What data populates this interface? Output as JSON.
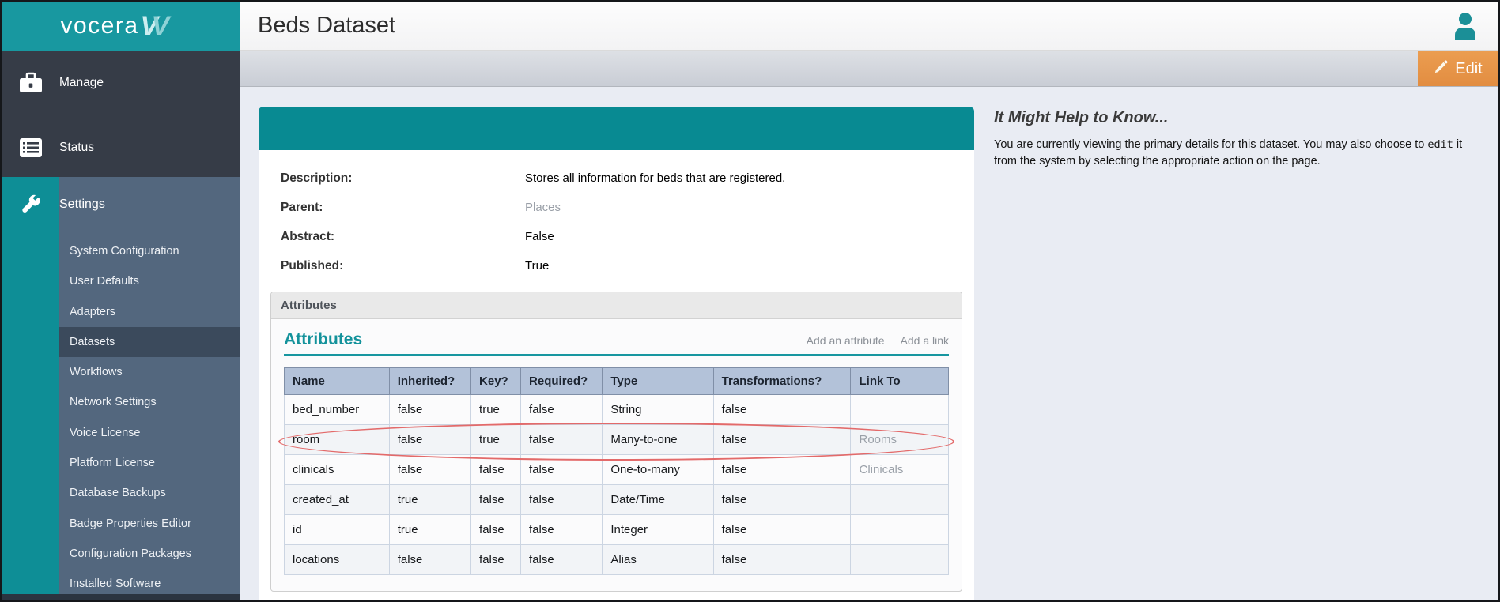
{
  "app": {
    "logo_text": "vocera",
    "page_title": "Beds Dataset"
  },
  "toolbar": {
    "edit_label": "Edit"
  },
  "sidebar": {
    "items": [
      {
        "label": "Manage",
        "icon": "briefcase-icon"
      },
      {
        "label": "Status",
        "icon": "status-list-icon"
      },
      {
        "label": "Settings",
        "icon": "wrench-icon",
        "active": true
      }
    ],
    "submenu": [
      {
        "label": "System Configuration",
        "selected": false
      },
      {
        "label": "User Defaults",
        "selected": false
      },
      {
        "label": "Adapters",
        "selected": false
      },
      {
        "label": "Datasets",
        "selected": true
      },
      {
        "label": "Workflows",
        "selected": false
      },
      {
        "label": "Network Settings",
        "selected": false
      },
      {
        "label": "Voice License",
        "selected": false
      },
      {
        "label": "Platform License",
        "selected": false
      },
      {
        "label": "Database Backups",
        "selected": false
      },
      {
        "label": "Badge Properties Editor",
        "selected": false
      },
      {
        "label": "Configuration Packages",
        "selected": false
      },
      {
        "label": "Installed Software",
        "selected": false
      }
    ]
  },
  "details": {
    "fields": [
      {
        "label": "Description:",
        "value": "Stores all information for beds that are registered.",
        "muted": false
      },
      {
        "label": "Parent:",
        "value": "Places",
        "muted": true
      },
      {
        "label": "Abstract:",
        "value": "False",
        "muted": false
      },
      {
        "label": "Published:",
        "value": "True",
        "muted": false
      }
    ]
  },
  "attributes": {
    "box_title": "Attributes",
    "section_title": "Attributes",
    "actions": [
      {
        "label": "Add an attribute"
      },
      {
        "label": "Add a link"
      }
    ],
    "table": {
      "headers": [
        "Name",
        "Inherited?",
        "Key?",
        "Required?",
        "Type",
        "Transformations?",
        "Link To"
      ],
      "rows": [
        {
          "cells": [
            "bed_number",
            "false",
            "true",
            "false",
            "String",
            "false",
            ""
          ],
          "annotated": false
        },
        {
          "cells": [
            "room",
            "false",
            "true",
            "false",
            "Many-to-one",
            "false",
            "Rooms"
          ],
          "annotated": true
        },
        {
          "cells": [
            "clinicals",
            "false",
            "false",
            "false",
            "One-to-many",
            "false",
            "Clinicals"
          ],
          "annotated": false
        },
        {
          "cells": [
            "created_at",
            "true",
            "false",
            "false",
            "Date/Time",
            "false",
            ""
          ],
          "annotated": false
        },
        {
          "cells": [
            "id",
            "true",
            "false",
            "false",
            "Integer",
            "false",
            ""
          ],
          "annotated": false
        },
        {
          "cells": [
            "locations",
            "false",
            "false",
            "false",
            "Alias",
            "false",
            ""
          ],
          "annotated": false
        }
      ]
    }
  },
  "help": {
    "title": "It Might Help to Know...",
    "body_before": "You are currently viewing the primary details for this dataset. You may also choose to ",
    "code": "edit",
    "body_after": " it from the system by selecting the appropriate action on the page."
  },
  "colors": {
    "brand_teal": "#1898a0",
    "accent_teal": "#0e8e96",
    "card_header_teal": "#088a92",
    "sidebar_dark": "#363c47",
    "sidebar_slate": "#53677e",
    "submenu_selected": "#3b4a5c",
    "edit_orange": "#e8944a",
    "table_header_bg": "#b3c2d9",
    "annotation_red": "#e36a6a",
    "link_gray": "#9aa0a8"
  }
}
